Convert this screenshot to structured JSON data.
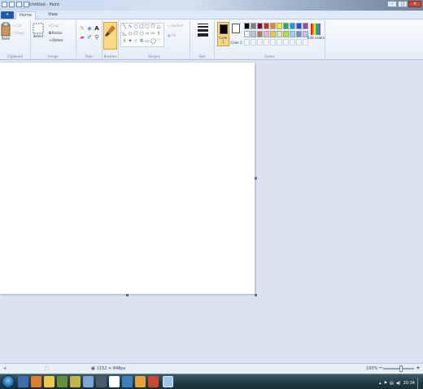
{
  "window": {
    "title": "Untitled - Paint",
    "buttons": {
      "minimize": "–",
      "maximize": "□",
      "close": "✕"
    }
  },
  "tabs": {
    "file": "▾",
    "home": "Home",
    "view": "View"
  },
  "ribbon": {
    "clipboard": {
      "paste": "Paste",
      "cut": "Cut",
      "copy": "Copy",
      "label": "Clipboard"
    },
    "image": {
      "select": "Select",
      "crop": "Crop",
      "resize": "Resize",
      "rotate": "Rotate",
      "label": "Image"
    },
    "tools": {
      "label": "Tools"
    },
    "brushes": {
      "label": "Brushes"
    },
    "shapes": {
      "outline": "Outline",
      "fill": "Fill",
      "label": "Shapes"
    },
    "size": {
      "label": "Size"
    },
    "colors": {
      "color1": "Color 1",
      "color2": "Color 2",
      "edit": "Edit colors",
      "label": "Colors"
    }
  },
  "palette_row1": [
    "#000000",
    "#7f7f7f",
    "#880015",
    "#ed1c24",
    "#ff7f27",
    "#fff200",
    "#22b14c",
    "#00a2e8",
    "#3f48cc",
    "#a349a4"
  ],
  "palette_row2": [
    "#ffffff",
    "#c3c3c3",
    "#b97a57",
    "#ffaec9",
    "#ffc90e",
    "#efe4b0",
    "#b5e61d",
    "#99d9ea",
    "#7092be",
    "#c8bfe7"
  ],
  "status": {
    "canvas_size": "1152 × 648px",
    "zoom": "100%"
  },
  "taskbar": {
    "time": "20:34"
  }
}
